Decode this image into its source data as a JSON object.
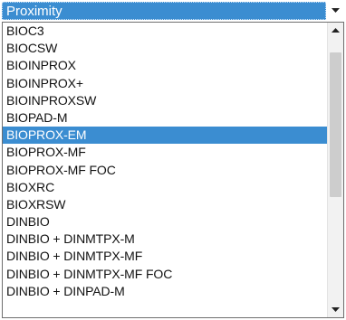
{
  "select": {
    "selected_value": "Proximity",
    "arrow_icon": "chevron-down-icon"
  },
  "dropdown": {
    "options": [
      "BIOC3",
      "BIOCSW",
      "BIOINPROX",
      "BIOINPROX+",
      "BIOINPROXSW",
      "BIOPAD-M",
      "BIOPROX-EM",
      "BIOPROX-MF",
      "BIOPROX-MF FOC",
      "BIOXRC",
      "BIOXRSW",
      "DINBIO",
      "DINBIO + DINMTPX-M",
      "DINBIO + DINMTPX-MF",
      "DINBIO + DINMTPX-MF FOC",
      "DINBIO + DINPAD-M"
    ],
    "highlighted_option": "BIOPROX-EM",
    "scroll_position": 0.12
  },
  "colors": {
    "selection": "#3b8dd1",
    "text": "#111111",
    "scrollbar_track": "#f2f2f2",
    "scrollbar_thumb": "#cdcdcd"
  }
}
